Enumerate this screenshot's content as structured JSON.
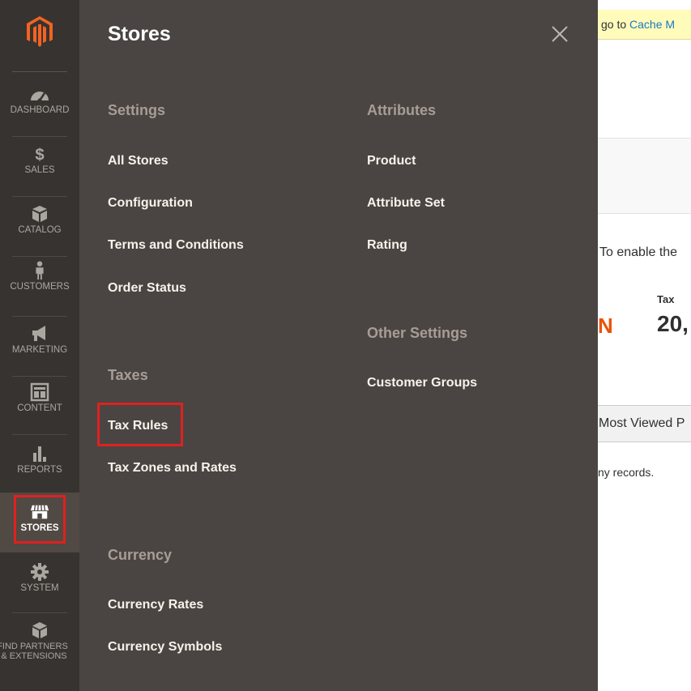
{
  "background": {
    "notice_prefix": "go to",
    "notice_link": "Cache M",
    "enable_text": "To enable the",
    "stat_letter": "N",
    "tax_label": "Tax",
    "tax_value": "20,",
    "tab_label": "Most Viewed P",
    "records_text": "ny records."
  },
  "nav": {
    "items": [
      {
        "label": "DASHBOARD",
        "icon": "dashboard-icon"
      },
      {
        "label": "SALES",
        "icon": "dollar-icon"
      },
      {
        "label": "CATALOG",
        "icon": "catalog-box-icon"
      },
      {
        "label": "CUSTOMERS",
        "icon": "customer-person-icon"
      },
      {
        "label": "MARKETING",
        "icon": "megaphone-icon"
      },
      {
        "label": "CONTENT",
        "icon": "content-layout-icon"
      },
      {
        "label": "REPORTS",
        "icon": "bar-chart-icon"
      },
      {
        "label": "STORES",
        "icon": "storefront-icon",
        "active": true
      },
      {
        "label": "SYSTEM",
        "icon": "gear-icon"
      },
      {
        "label_line1": "FIND PARTNERS",
        "label_line2": "& EXTENSIONS",
        "icon": "extensions-cube-icon"
      }
    ]
  },
  "flyout": {
    "title": "Stores",
    "close_icon": "close-icon",
    "sections": {
      "settings": {
        "title": "Settings",
        "links": [
          "All Stores",
          "Configuration",
          "Terms and Conditions",
          "Order Status"
        ]
      },
      "taxes": {
        "title": "Taxes",
        "links": [
          "Tax Rules",
          "Tax Zones and Rates"
        ]
      },
      "currency": {
        "title": "Currency",
        "links": [
          "Currency Rates",
          "Currency Symbols"
        ]
      },
      "attributes": {
        "title": "Attributes",
        "links": [
          "Product",
          "Attribute Set",
          "Rating"
        ]
      },
      "other_settings": {
        "title": "Other Settings",
        "links": [
          "Customer Groups"
        ]
      }
    }
  },
  "colors": {
    "nav_bg": "#373330",
    "flyout_bg": "#4a4542",
    "highlight": "#e02020",
    "brand_orange": "#eb5202"
  }
}
